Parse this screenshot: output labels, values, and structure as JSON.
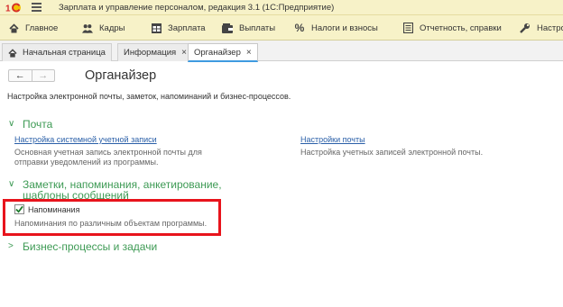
{
  "window": {
    "title": "Зарплата и управление персоналом, редакция 3.1  (1С:Предприятие)"
  },
  "menu": {
    "items": [
      {
        "label": "Главное",
        "icon": "home-icon"
      },
      {
        "label": "Кадры",
        "icon": "people-icon"
      },
      {
        "label": "Зарплата",
        "icon": "payroll-grid-icon"
      },
      {
        "label": "Выплаты",
        "icon": "wallet-icon"
      },
      {
        "label": "Налоги и взносы",
        "icon": "percent-icon"
      },
      {
        "label": "Отчетность, справки",
        "icon": "report-icon"
      },
      {
        "label": "Настро",
        "icon": "wrench-icon"
      }
    ]
  },
  "tabs": [
    {
      "label": "Начальная страница",
      "icon": "home-icon"
    },
    {
      "label": "Информация",
      "close": "×"
    },
    {
      "label": "Органайзер",
      "close": "×",
      "active": true
    }
  ],
  "page": {
    "title": "Органайзер",
    "description": "Настройка электронной почты, заметок, напоминаний и бизнес-процессов.",
    "nav": {
      "back": "←",
      "forward": "→"
    }
  },
  "sections": {
    "mail": {
      "title": "Почта",
      "expanded": true,
      "system_account_link": "Настройка системной учетной записи",
      "system_account_hint": "Основная учетная запись электронной почты для отправки уведомлений из программы.",
      "mail_settings_link": "Настройки почты",
      "mail_settings_hint": "Настройка учетных записей электронной почты."
    },
    "notes": {
      "title": "Заметки, напоминания, анкетирование, шаблоны сообщений",
      "expanded": true,
      "reminders_label": "Напоминания",
      "reminders_checked": true,
      "reminders_hint": "Напоминания по различным объектам программы."
    },
    "bp": {
      "title": "Бизнес-процессы и задачи",
      "expanded": false
    }
  },
  "colors": {
    "titlebar_bg": "#f7f2c8",
    "section_green": "#3d9a54",
    "link_blue": "#2a5fa8",
    "highlight_red": "#e8141c",
    "logo_red": "#d62b2b",
    "logo_yellow": "#f2c200",
    "active_tab_underline": "#3f9be0"
  }
}
